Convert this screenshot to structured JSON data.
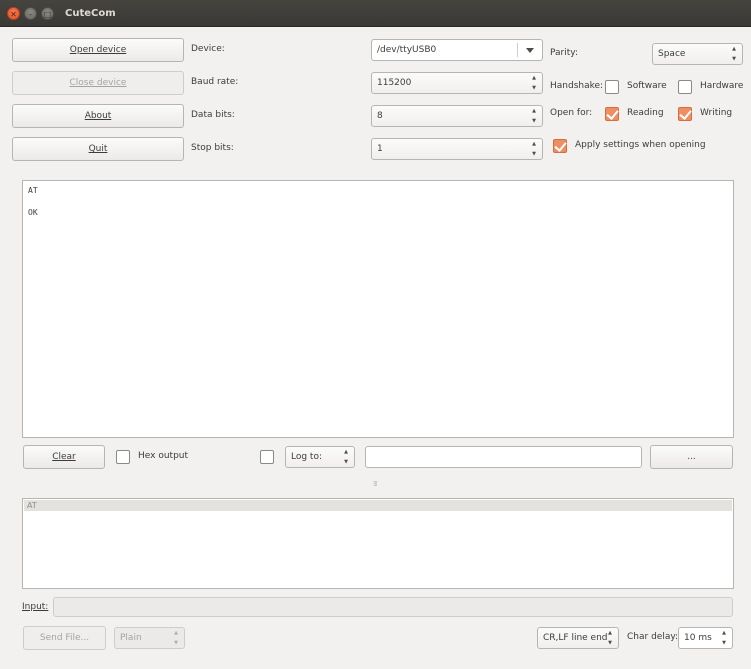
{
  "window": {
    "title": "CuteCom"
  },
  "buttons": {
    "open_device": "Open device",
    "close_device": "Close device",
    "about": "About",
    "quit": "Quit",
    "clear": "Clear",
    "browse": "...",
    "send_file": "Send File..."
  },
  "settings": {
    "device": {
      "label": "Device:",
      "value": "/dev/ttyUSB0"
    },
    "baud_rate": {
      "label": "Baud rate:",
      "value": "115200"
    },
    "data_bits": {
      "label": "Data bits:",
      "value": "8"
    },
    "stop_bits": {
      "label": "Stop bits:",
      "value": "1"
    },
    "parity": {
      "label": "Parity:",
      "value": "Space"
    },
    "handshake": {
      "label": "Handshake:",
      "software": "Software",
      "hardware": "Hardware",
      "software_checked": false,
      "hardware_checked": false
    },
    "open_for": {
      "label": "Open for:",
      "reading": "Reading",
      "writing": "Writing",
      "reading_checked": true,
      "writing_checked": true
    },
    "apply_on_open": {
      "label": "Apply settings when opening",
      "checked": true
    }
  },
  "output": {
    "lines": [
      "AT",
      "OK"
    ]
  },
  "output_controls": {
    "hex_output": {
      "label": "Hex output",
      "checked": false
    },
    "log_enabled": false,
    "log_to": "Log to:",
    "log_path": ""
  },
  "splitter_handle": "⁞⁞⁞",
  "history": {
    "items": [
      "AT"
    ]
  },
  "input": {
    "label": "Input:",
    "value": ""
  },
  "bottom": {
    "send_mode": "Plain",
    "line_end": "CR,LF line end",
    "char_delay_label": "Char delay:",
    "char_delay_value": "10 ms"
  },
  "colors": {
    "accent": "#f08e63",
    "titlebar": "#3c3b37"
  }
}
